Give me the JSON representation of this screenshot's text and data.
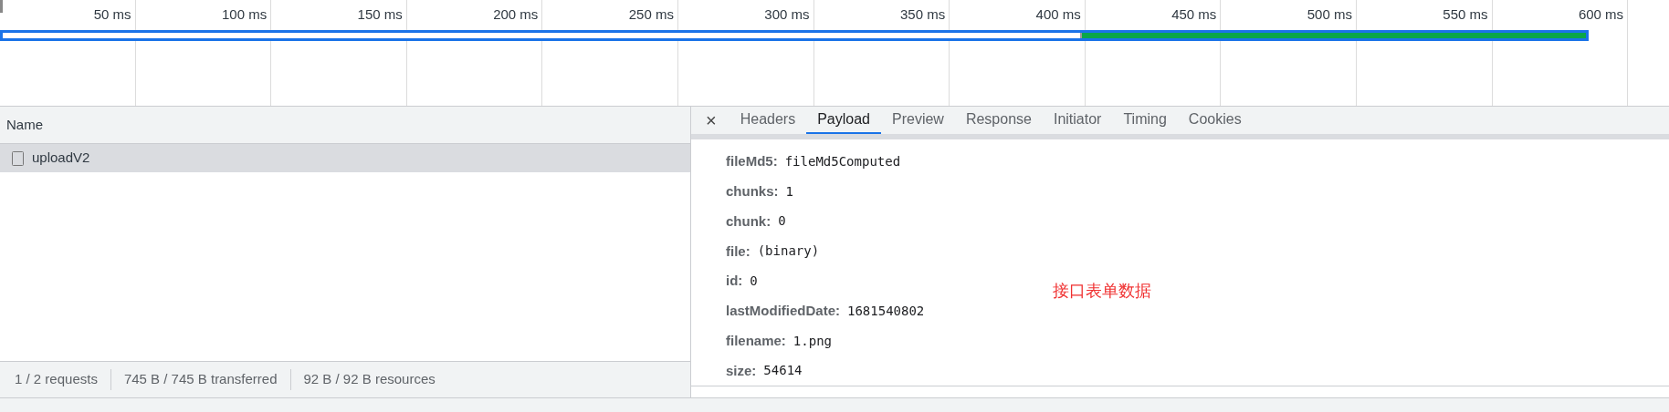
{
  "timeline": {
    "ticks": [
      "50 ms",
      "100 ms",
      "150 ms",
      "200 ms",
      "250 ms",
      "300 ms",
      "350 ms",
      "400 ms",
      "450 ms",
      "500 ms",
      "550 ms",
      "600 ms"
    ]
  },
  "request_list": {
    "column_header": "Name",
    "rows": [
      {
        "name": "uploadV2",
        "selected": true
      }
    ],
    "status_bar": [
      "1 / 2 requests",
      "745 B / 745 B transferred",
      "92 B / 92 B resources"
    ]
  },
  "detail": {
    "close": "×",
    "tabs": [
      {
        "label": "Headers",
        "selected": false
      },
      {
        "label": "Payload",
        "selected": true
      },
      {
        "label": "Preview",
        "selected": false
      },
      {
        "label": "Response",
        "selected": false
      },
      {
        "label": "Initiator",
        "selected": false
      },
      {
        "label": "Timing",
        "selected": false
      },
      {
        "label": "Cookies",
        "selected": false
      }
    ],
    "payload": [
      {
        "key": "fileMd5:",
        "value": "fileMd5Computed"
      },
      {
        "key": "chunks:",
        "value": "1"
      },
      {
        "key": "chunk:",
        "value": "0"
      },
      {
        "key": "file:",
        "value": "(binary)"
      },
      {
        "key": "id:",
        "value": "0"
      },
      {
        "key": "lastModifiedDate:",
        "value": "1681540802"
      },
      {
        "key": "filename:",
        "value": "1.png"
      },
      {
        "key": "size:",
        "value": "54614"
      }
    ],
    "annotation": "接口表单数据"
  }
}
